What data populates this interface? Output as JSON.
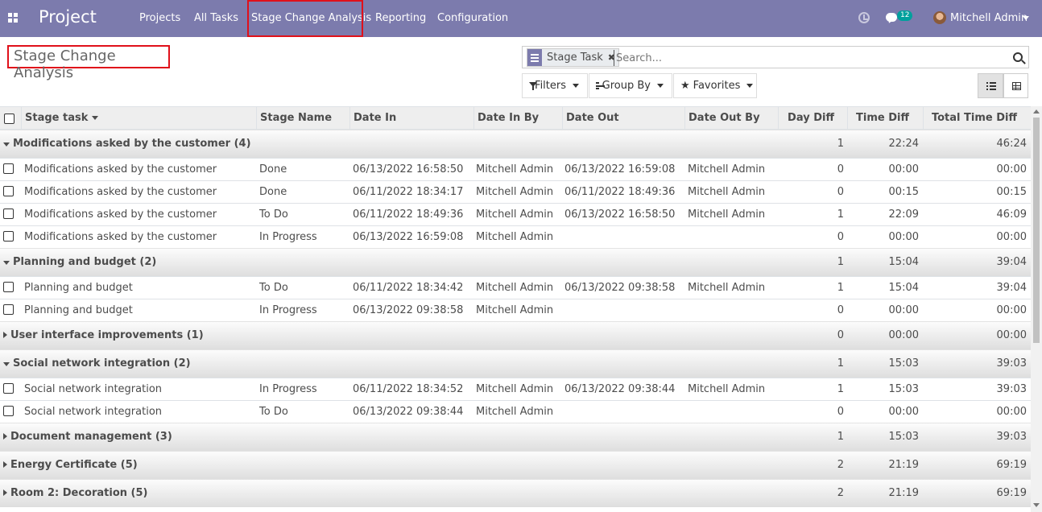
{
  "navbar": {
    "brand": "Project",
    "menu": [
      "Projects",
      "All Tasks",
      "Stage Change Analysis",
      "Reporting",
      "Configuration"
    ],
    "chat_count": "12",
    "user": "Mitchell Admin",
    "color": "#7c7bad"
  },
  "page_title": "Stage Change Analysis",
  "search": {
    "facet": "Stage Task",
    "placeholder": "Search..."
  },
  "controls": {
    "filters": "Filters",
    "group_by": "Group By",
    "favorites": "Favorites"
  },
  "columns": [
    "Stage task",
    "Stage Name",
    "Date In",
    "Date In By",
    "Date Out",
    "Date Out By",
    "Day Diff",
    "Time Diff",
    "Total Time Diff"
  ],
  "groups": [
    {
      "label": "Modifications asked by the customer (4)",
      "open": true,
      "day_diff": "1",
      "time_diff": "22:24",
      "total": "46:24",
      "rows": [
        [
          "Modifications asked by the customer",
          "Done",
          "06/13/2022 16:58:50",
          "Mitchell Admin",
          "06/13/2022 16:59:08",
          "Mitchell Admin",
          "0",
          "00:00",
          "00:00"
        ],
        [
          "Modifications asked by the customer",
          "Done",
          "06/11/2022 18:34:17",
          "Mitchell Admin",
          "06/11/2022 18:49:36",
          "Mitchell Admin",
          "0",
          "00:15",
          "00:15"
        ],
        [
          "Modifications asked by the customer",
          "To Do",
          "06/11/2022 18:49:36",
          "Mitchell Admin",
          "06/13/2022 16:58:50",
          "Mitchell Admin",
          "1",
          "22:09",
          "46:09"
        ],
        [
          "Modifications asked by the customer",
          "In Progress",
          "06/13/2022 16:59:08",
          "Mitchell Admin",
          "",
          "",
          "0",
          "00:00",
          "00:00"
        ]
      ]
    },
    {
      "label": "Planning and budget (2)",
      "open": true,
      "day_diff": "1",
      "time_diff": "15:04",
      "total": "39:04",
      "rows": [
        [
          "Planning and budget",
          "To Do",
          "06/11/2022 18:34:42",
          "Mitchell Admin",
          "06/13/2022 09:38:58",
          "Mitchell Admin",
          "1",
          "15:04",
          "39:04"
        ],
        [
          "Planning and budget",
          "In Progress",
          "06/13/2022 09:38:58",
          "Mitchell Admin",
          "",
          "",
          "0",
          "00:00",
          "00:00"
        ]
      ]
    },
    {
      "label": "User interface improvements (1)",
      "open": false,
      "day_diff": "0",
      "time_diff": "00:00",
      "total": "00:00",
      "rows": []
    },
    {
      "label": "Social network integration (2)",
      "open": true,
      "day_diff": "1",
      "time_diff": "15:03",
      "total": "39:03",
      "rows": [
        [
          "Social network integration",
          "In Progress",
          "06/11/2022 18:34:52",
          "Mitchell Admin",
          "06/13/2022 09:38:44",
          "Mitchell Admin",
          "1",
          "15:03",
          "39:03"
        ],
        [
          "Social network integration",
          "To Do",
          "06/13/2022 09:38:44",
          "Mitchell Admin",
          "",
          "",
          "0",
          "00:00",
          "00:00"
        ]
      ]
    },
    {
      "label": "Document management (3)",
      "open": false,
      "day_diff": "1",
      "time_diff": "15:03",
      "total": "39:03",
      "rows": []
    },
    {
      "label": "Energy Certificate (5)",
      "open": false,
      "day_diff": "2",
      "time_diff": "21:19",
      "total": "69:19",
      "rows": []
    },
    {
      "label": "Room 2: Decoration (5)",
      "open": false,
      "day_diff": "2",
      "time_diff": "21:19",
      "total": "69:19",
      "rows": []
    }
  ]
}
